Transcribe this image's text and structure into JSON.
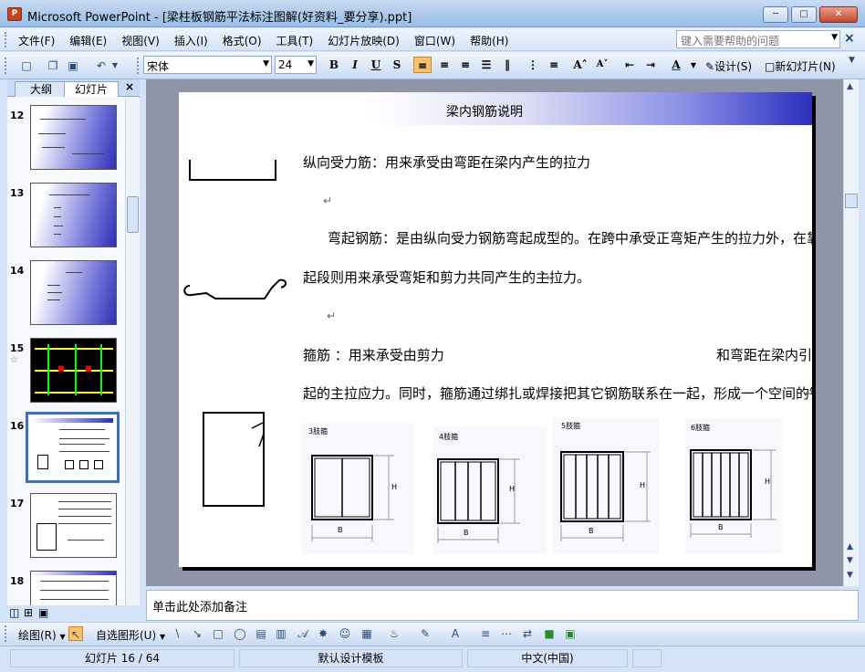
{
  "window": {
    "title": "Microsoft PowerPoint - [梁柱板钢筋平法标注图解(好资料_要分享).ppt]",
    "app_icon": "P"
  },
  "menu": {
    "items": [
      "文件(F)",
      "编辑(E)",
      "视图(V)",
      "插入(I)",
      "格式(O)",
      "工具(T)",
      "幻灯片放映(D)",
      "窗口(W)",
      "帮助(H)"
    ],
    "help_placeholder": "键入需要帮助的问题"
  },
  "toolbar": {
    "font_name": "宋体",
    "font_size": "24",
    "bold": "B",
    "italic": "I",
    "underline": "U",
    "shadow": "S",
    "design_label": "设计(S)",
    "new_slide_label": "新幻灯片(N)"
  },
  "left_pane": {
    "tabs": [
      "大纲",
      "幻灯片"
    ],
    "thumbnails": [
      {
        "number": "12"
      },
      {
        "number": "13"
      },
      {
        "number": "14"
      },
      {
        "number": "15"
      },
      {
        "number": "16",
        "selected": true
      },
      {
        "number": "17"
      },
      {
        "number": "18"
      }
    ]
  },
  "slide": {
    "title": "梁内钢筋说明",
    "line1": "纵向受力筋：用来承受由弯距在梁内产生的拉力",
    "line2": "弯起钢筋：是由纵向受力钢筋弯起成型的。在跨中承受正弯矩产生的拉力外，在靠近支座的弯",
    "line3": "起段则用来承受弯矩和剪力共同产生的主拉力。",
    "line4a": "箍筋 ：用来承受由剪力",
    "line4b": "和弯距在梁内引",
    "line5": "起的主拉应力。同时，箍筋通过绑扎或焊接把其它钢筋联系在一起，形成一个空间的钢筋骨架。",
    "para_mark": "↵",
    "diagrams": [
      {
        "label": "3肢箍",
        "h": "H",
        "b": "B"
      },
      {
        "label": "4肢箍",
        "h": "H",
        "b": "B"
      },
      {
        "label": "5肢箍",
        "h": "H",
        "b": "B"
      },
      {
        "label": "6肢箍",
        "h": "H",
        "b": "B"
      }
    ]
  },
  "notes": {
    "placeholder": "单击此处添加备注"
  },
  "drawing_toolbar": {
    "draw_label": "绘图(R)",
    "autoshapes_label": "自选图形(U)"
  },
  "status": {
    "slide_info": "幻灯片 16 / 64",
    "template": "默认设计模板",
    "language": "中文(中国)"
  }
}
